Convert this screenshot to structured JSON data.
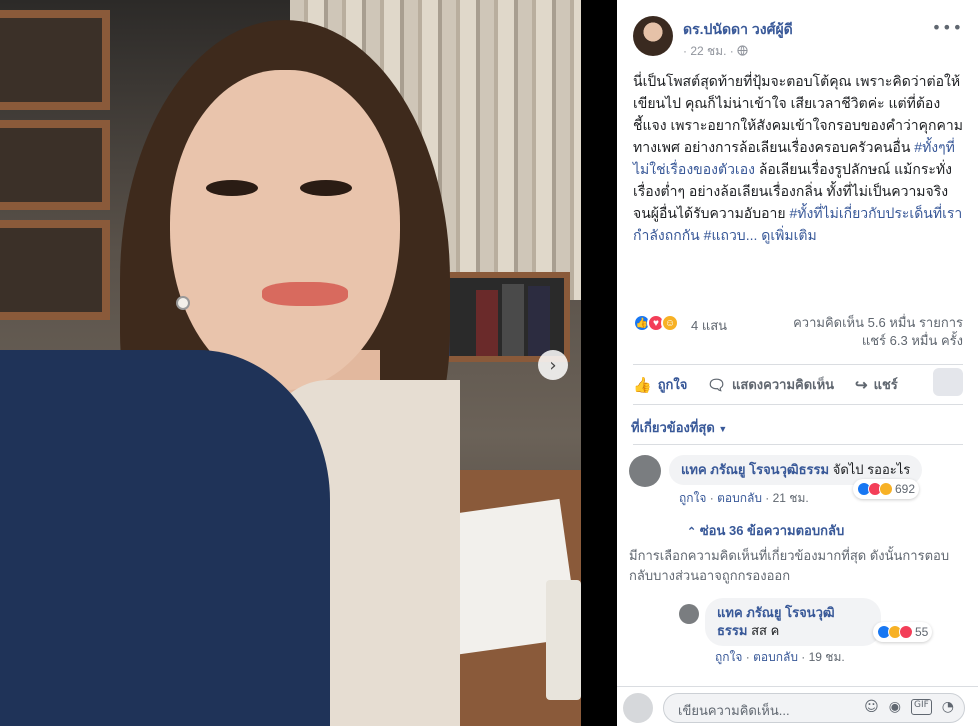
{
  "post": {
    "author": "ดร.ปนัดดา วงศ์ผู้ดี",
    "time": "22 ชม.",
    "privacy_icon": "globe-icon",
    "text_plain_1": "นี่เป็นโพสต์สุดท้ายที่ปุ้มจะตอบโต้คุณ เพราะคิดว่าต่อให้เขียนไป คุณก็ไม่น่าเข้าใจ เสียเวลาชีวิตค่ะ แต่ที่ต้องชี้แจง เพราะอยากให้สังคมเข้าใจกรอบของคำว่าคุกคามทางเพศ อย่างการล้อเลียนเรื่องครอบครัวคนอื่น ",
    "hashtag_1": "#ทั้งๆที่ไม่ใช่เรื่องของตัวเอง",
    "text_plain_2": " ล้อเลียนเรื่องรูปลักษณ์ แม้กระทั่งเรื่องต่ำๆ อย่างล้อเลียนเรื่องกลิ่น ทั้งที่ไม่เป็นความจริง จนผู้อื่นได้รับความอับอาย ",
    "hashtag_2": "#ทั้งที่ไม่เกี่ยวกับประเด็นที่เรากำลังถกกัน",
    "hashtag_3": "#แถวบ...",
    "see_more": "ดูเพิ่มเติม"
  },
  "reactions": {
    "count": "4 แสน",
    "comments": "ความคิดเห็น 5.6 หมื่น รายการ",
    "shares": "แชร์ 6.3 หมื่น ครั้ง"
  },
  "actions": {
    "like": "ถูกใจ",
    "comment": "แสดงความคิดเห็น",
    "share": "แชร์"
  },
  "filter_label": "ที่เกี่ยวข้องที่สุด",
  "comments": [
    {
      "name": "แทค ภรัณยู โรจนวุฒิธรรม",
      "text": "จัดไป รออะไร",
      "like": "ถูกใจ",
      "reply": "ตอบกลับ",
      "time": "21 ชม.",
      "reaction_count": "692"
    }
  ],
  "hide_replies": "ซ่อน 36 ข้อความตอบกลับ",
  "notice": "มีการเลือกความคิดเห็นที่เกี่ยวข้องมากที่สุด ดังนั้นการตอบกลับบางส่วนอาจถูกกรองออก",
  "reply": {
    "name_line1": "แทค ภรัณยู โรจนวุฒิ",
    "name_line2": "ธรรม",
    "text": "สส ค",
    "like": "ถูกใจ",
    "reply": "ตอบกลับ",
    "time": "19 ชม.",
    "reaction_count": "55"
  },
  "composer": {
    "placeholder": "เขียนความคิดเห็น..."
  },
  "colors": {
    "link": "#385898",
    "like_blue": "#1877f2",
    "love_red": "#f33e58",
    "haha_yellow": "#f7b125"
  }
}
